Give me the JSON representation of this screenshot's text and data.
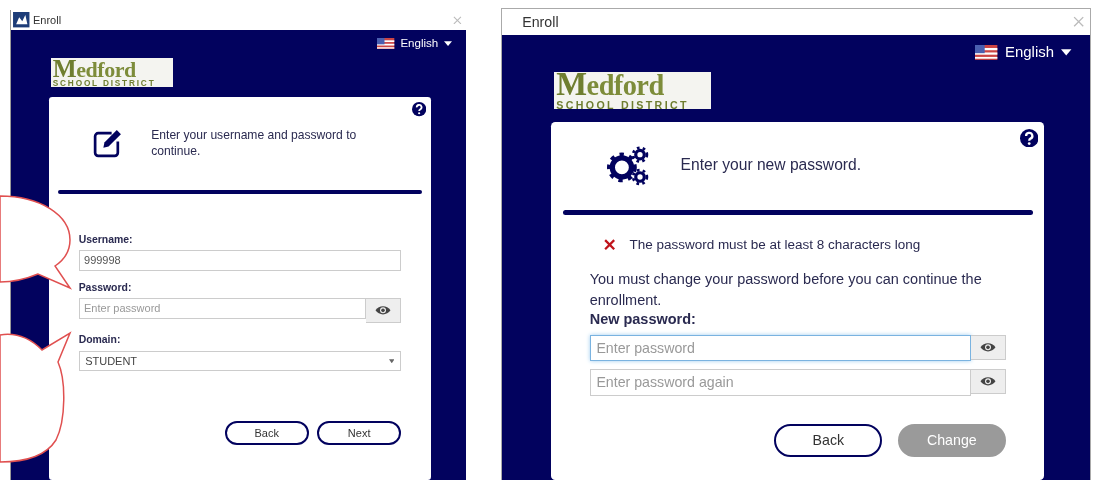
{
  "windows": [
    {
      "kind": "login",
      "title": "Enroll",
      "language": "English",
      "logo": {
        "name": "Medford",
        "subtitle": "SCHOOL DISTRICT"
      },
      "card": {
        "heading": "Enter your username and password to continue.",
        "fields": [
          {
            "label": "Username:",
            "kind": "text",
            "value": "999998"
          },
          {
            "label": "Password:",
            "kind": "password",
            "placeholder": "Enter password"
          },
          {
            "label": "Domain:",
            "kind": "select",
            "value": "STUDENT"
          }
        ],
        "buttons": [
          {
            "label": "Back",
            "disabled": false
          },
          {
            "label": "Next",
            "disabled": false
          }
        ]
      }
    },
    {
      "kind": "change_password",
      "title": "Enroll",
      "language": "English",
      "logo": {
        "name": "Medford",
        "subtitle": "SCHOOL DISTRICT"
      },
      "card": {
        "heading": "Enter your new password.",
        "errors": [
          "The password must be at least 8 characters long"
        ],
        "intro": "You must change your password before you can continue the enrollment.",
        "fields": [
          {
            "label": "New password:",
            "kind": "password",
            "placeholder": "Enter password",
            "focused": true
          },
          {
            "kind": "password",
            "placeholder": "Enter password again",
            "focused": false
          }
        ],
        "buttons": [
          {
            "label": "Back",
            "disabled": false
          },
          {
            "label": "Change",
            "disabled": true
          }
        ]
      }
    }
  ]
}
